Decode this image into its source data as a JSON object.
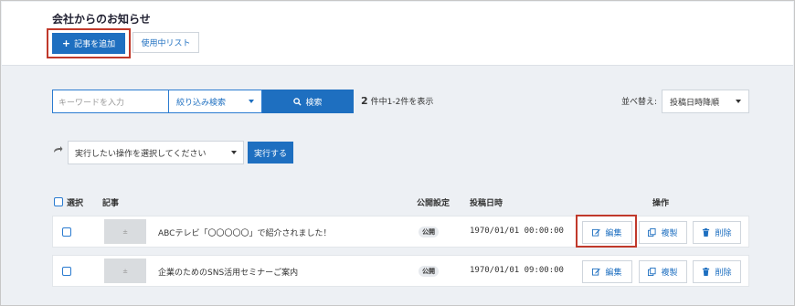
{
  "header": {
    "title": "会社からのお知らせ",
    "add_button": "記事を追加",
    "list_button": "使用中リスト"
  },
  "search": {
    "placeholder": "キーワードを入力",
    "filter_label": "絞り込み検索",
    "search_button": "検索",
    "result_count": "2",
    "result_text": "件中1-2件を表示"
  },
  "sort": {
    "label": "並べ替え:",
    "value": "投稿日時降順"
  },
  "bulk": {
    "select_placeholder": "実行したい操作を選択してください",
    "execute_button": "実行する"
  },
  "table": {
    "headers": {
      "select": "選択",
      "article": "記事",
      "visibility": "公開設定",
      "date": "投稿日時",
      "actions": "操作"
    },
    "rows": [
      {
        "title": "ABCテレビ「〇〇〇〇〇」で紹介されました！",
        "visibility": "公開",
        "date": "1970/01/01 00:00:00"
      },
      {
        "title": "企業のためのSNS活用セミナーご案内",
        "visibility": "公開",
        "date": "1970/01/01 09:00:00"
      }
    ],
    "actions": {
      "edit": "編集",
      "copy": "複製",
      "delete": "削除"
    }
  },
  "colors": {
    "primary": "#1e6fc0",
    "highlight": "#c0392b",
    "background": "#edf0f4"
  }
}
